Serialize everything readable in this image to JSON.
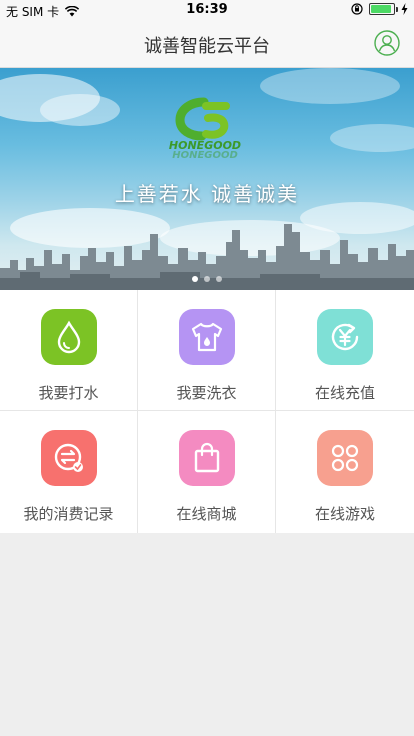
{
  "status_bar": {
    "carrier": "无 SIM 卡",
    "time": "16:39",
    "battery_level": 0.92
  },
  "nav": {
    "title": "诚善智能云平台",
    "user_icon": "user-icon"
  },
  "banner": {
    "logo_text": "HONEGOOD",
    "slogan": "上善若水 诚善诚美",
    "page_count": 3,
    "active_page": 1
  },
  "menu": [
    {
      "label": "我要打水",
      "icon": "water-drop-icon",
      "color": "#7cc325"
    },
    {
      "label": "我要洗衣",
      "icon": "laundry-shirt-icon",
      "color": "#b594f3"
    },
    {
      "label": "在线充值",
      "icon": "recharge-yuan-icon",
      "color": "#7fe0d6"
    },
    {
      "label": "我的消费记录",
      "icon": "consumption-record-icon",
      "color": "#f7716e"
    },
    {
      "label": "在线商城",
      "icon": "shopping-bag-icon",
      "color": "#f48bc1"
    },
    {
      "label": "在线游戏",
      "icon": "game-grid-icon",
      "color": "#f7a08f"
    }
  ]
}
